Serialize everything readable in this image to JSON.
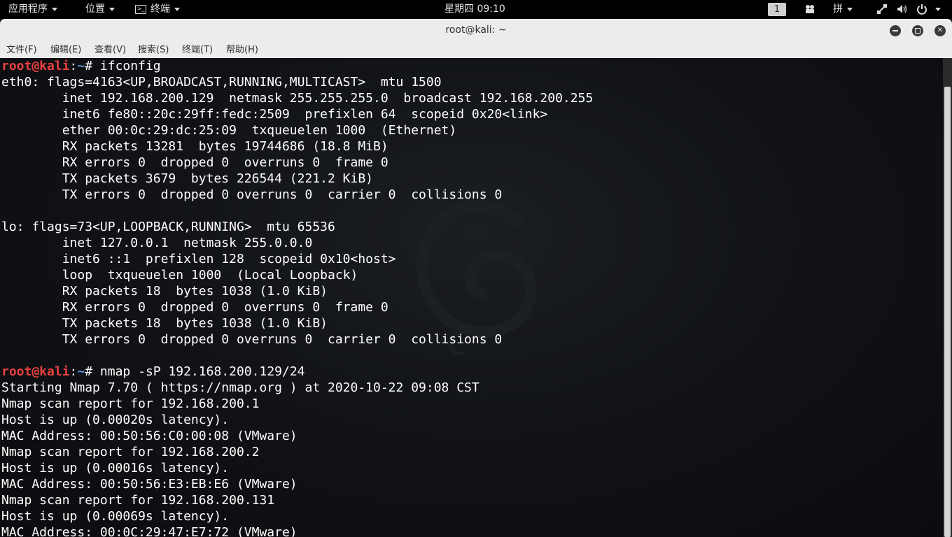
{
  "topbar": {
    "applications": "应用程序",
    "places": "位置",
    "terminal_app": "终端",
    "clock": "星期四 09:10",
    "workspace": "1",
    "input_method": "拼"
  },
  "window": {
    "title": "root@kali: ~"
  },
  "menubar": {
    "items": [
      "文件(F)",
      "编辑(E)",
      "查看(V)",
      "搜索(S)",
      "终端(T)",
      "帮助(H)"
    ]
  },
  "terminal": {
    "prompt_user": "root@kali",
    "prompt_path": "~",
    "lines": [
      {
        "prompt": true,
        "text": "ifconfig"
      },
      {
        "text": "eth0: flags=4163<UP,BROADCAST,RUNNING,MULTICAST>  mtu 1500"
      },
      {
        "text": "        inet 192.168.200.129  netmask 255.255.255.0  broadcast 192.168.200.255"
      },
      {
        "text": "        inet6 fe80::20c:29ff:fedc:2509  prefixlen 64  scopeid 0x20<link>"
      },
      {
        "text": "        ether 00:0c:29:dc:25:09  txqueuelen 1000  (Ethernet)"
      },
      {
        "text": "        RX packets 13281  bytes 19744686 (18.8 MiB)"
      },
      {
        "text": "        RX errors 0  dropped 0  overruns 0  frame 0"
      },
      {
        "text": "        TX packets 3679  bytes 226544 (221.2 KiB)"
      },
      {
        "text": "        TX errors 0  dropped 0 overruns 0  carrier 0  collisions 0"
      },
      {
        "text": ""
      },
      {
        "text": "lo: flags=73<UP,LOOPBACK,RUNNING>  mtu 65536"
      },
      {
        "text": "        inet 127.0.0.1  netmask 255.0.0.0"
      },
      {
        "text": "        inet6 ::1  prefixlen 128  scopeid 0x10<host>"
      },
      {
        "text": "        loop  txqueuelen 1000  (Local Loopback)"
      },
      {
        "text": "        RX packets 18  bytes 1038 (1.0 KiB)"
      },
      {
        "text": "        RX errors 0  dropped 0  overruns 0  frame 0"
      },
      {
        "text": "        TX packets 18  bytes 1038 (1.0 KiB)"
      },
      {
        "text": "        TX errors 0  dropped 0 overruns 0  carrier 0  collisions 0"
      },
      {
        "text": ""
      },
      {
        "prompt": true,
        "text": "nmap -sP 192.168.200.129/24"
      },
      {
        "text": "Starting Nmap 7.70 ( https://nmap.org ) at 2020-10-22 09:08 CST"
      },
      {
        "text": "Nmap scan report for 192.168.200.1"
      },
      {
        "text": "Host is up (0.00020s latency)."
      },
      {
        "text": "MAC Address: 00:50:56:C0:00:08 (VMware)"
      },
      {
        "text": "Nmap scan report for 192.168.200.2"
      },
      {
        "text": "Host is up (0.00016s latency)."
      },
      {
        "text": "MAC Address: 00:50:56:E3:EB:E6 (VMware)"
      },
      {
        "text": "Nmap scan report for 192.168.200.131"
      },
      {
        "text": "Host is up (0.00069s latency)."
      },
      {
        "text": "MAC Address: 00:0C:29:47:E7:72 (VMware)"
      }
    ]
  },
  "colors": {
    "prompt_user": "#e8403e",
    "prompt_path": "#5c8ed8",
    "terminal_bg": "#0d0f12"
  }
}
